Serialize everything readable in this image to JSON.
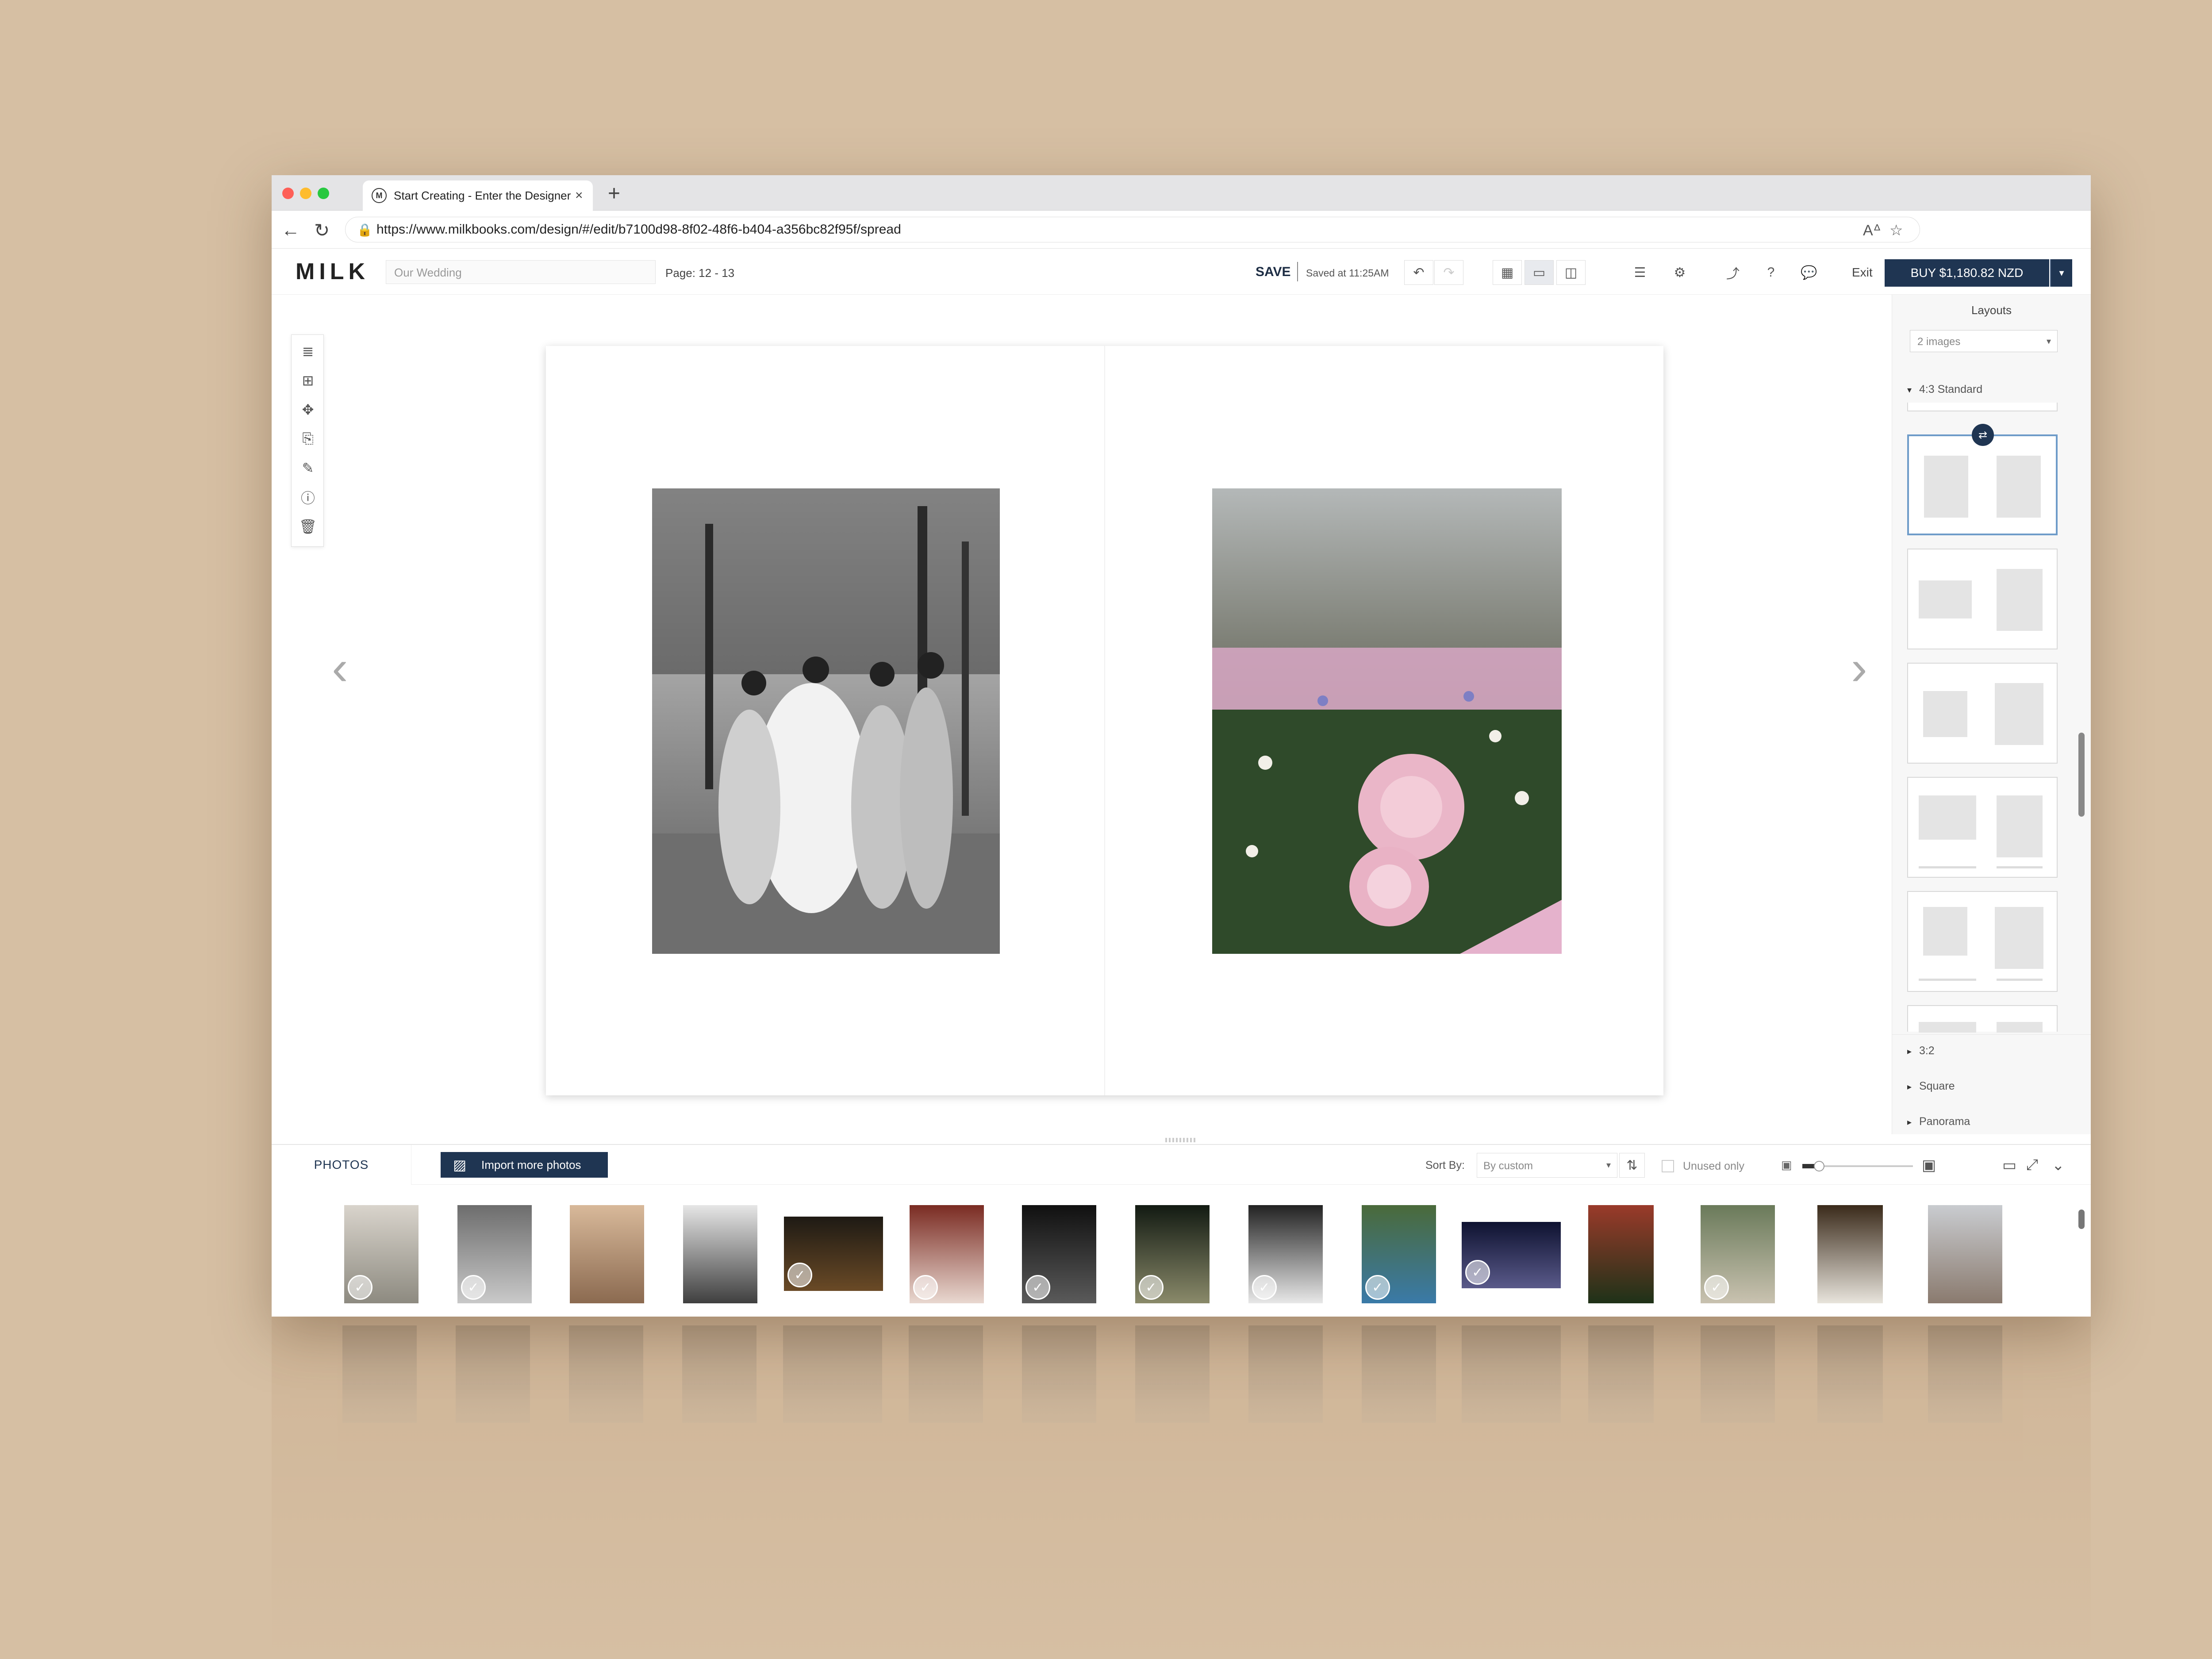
{
  "browser": {
    "tab_title": "Start Creating - Enter the Designer",
    "tab_favicon": "M",
    "url": "https://www.milkbooks.com/design/#/edit/b7100d98-8f02-48f6-b404-a356bc82f95f/spread"
  },
  "app": {
    "logo": "MILK",
    "project_name_placeholder": "Our Wedding",
    "page_label": "Page: 12 - 13",
    "save_label": "SAVE",
    "saved_at": "Saved at 11:25AM",
    "exit_label": "Exit",
    "buy_label": "BUY $1,180.82 NZD",
    "accent_color": "#1f3552"
  },
  "layouts_panel": {
    "title": "Layouts",
    "filter_value": "2 images",
    "sections": {
      "standard": "4:3 Standard",
      "three_two": "3:2",
      "square": "Square",
      "panorama": "Panorama"
    }
  },
  "photos_bar": {
    "tab_label": "PHOTOS",
    "import_label": "Import more photos",
    "sort_label": "Sort By:",
    "sort_value": "By custom",
    "unused_label": "Unused only"
  },
  "thumbnails": {
    "count": 15,
    "checked": [
      true,
      true,
      false,
      false,
      true,
      true,
      true,
      true,
      true,
      true,
      true,
      false,
      true,
      false,
      false
    ]
  },
  "icons": {
    "back": "←",
    "reload": "↻",
    "lock": "🔒",
    "read_aloud": "Aᐞ",
    "favorite": "☆",
    "undo": "↶",
    "redo": "↷",
    "grid_view": "▦",
    "spread_view": "▭",
    "page_view": "◫",
    "list": "☰",
    "settings": "⚙",
    "share": "⤴",
    "help": "?",
    "chat": "💬",
    "caret": "▾",
    "prev": "‹",
    "next": "›",
    "swap": "⇄",
    "check": "✓",
    "sort_order": "⇅",
    "image_small": "▣",
    "image_large": "▣",
    "expand": "⤢",
    "collapse": "⌄",
    "tool_text": "≣",
    "tool_add_frame": "⊞",
    "tool_scatter": "✥",
    "tool_copy": "⎘",
    "tool_edit": "✎",
    "tool_info": "ⓘ",
    "tool_trash": "🗑",
    "import": "▨",
    "monitor": "▭"
  }
}
